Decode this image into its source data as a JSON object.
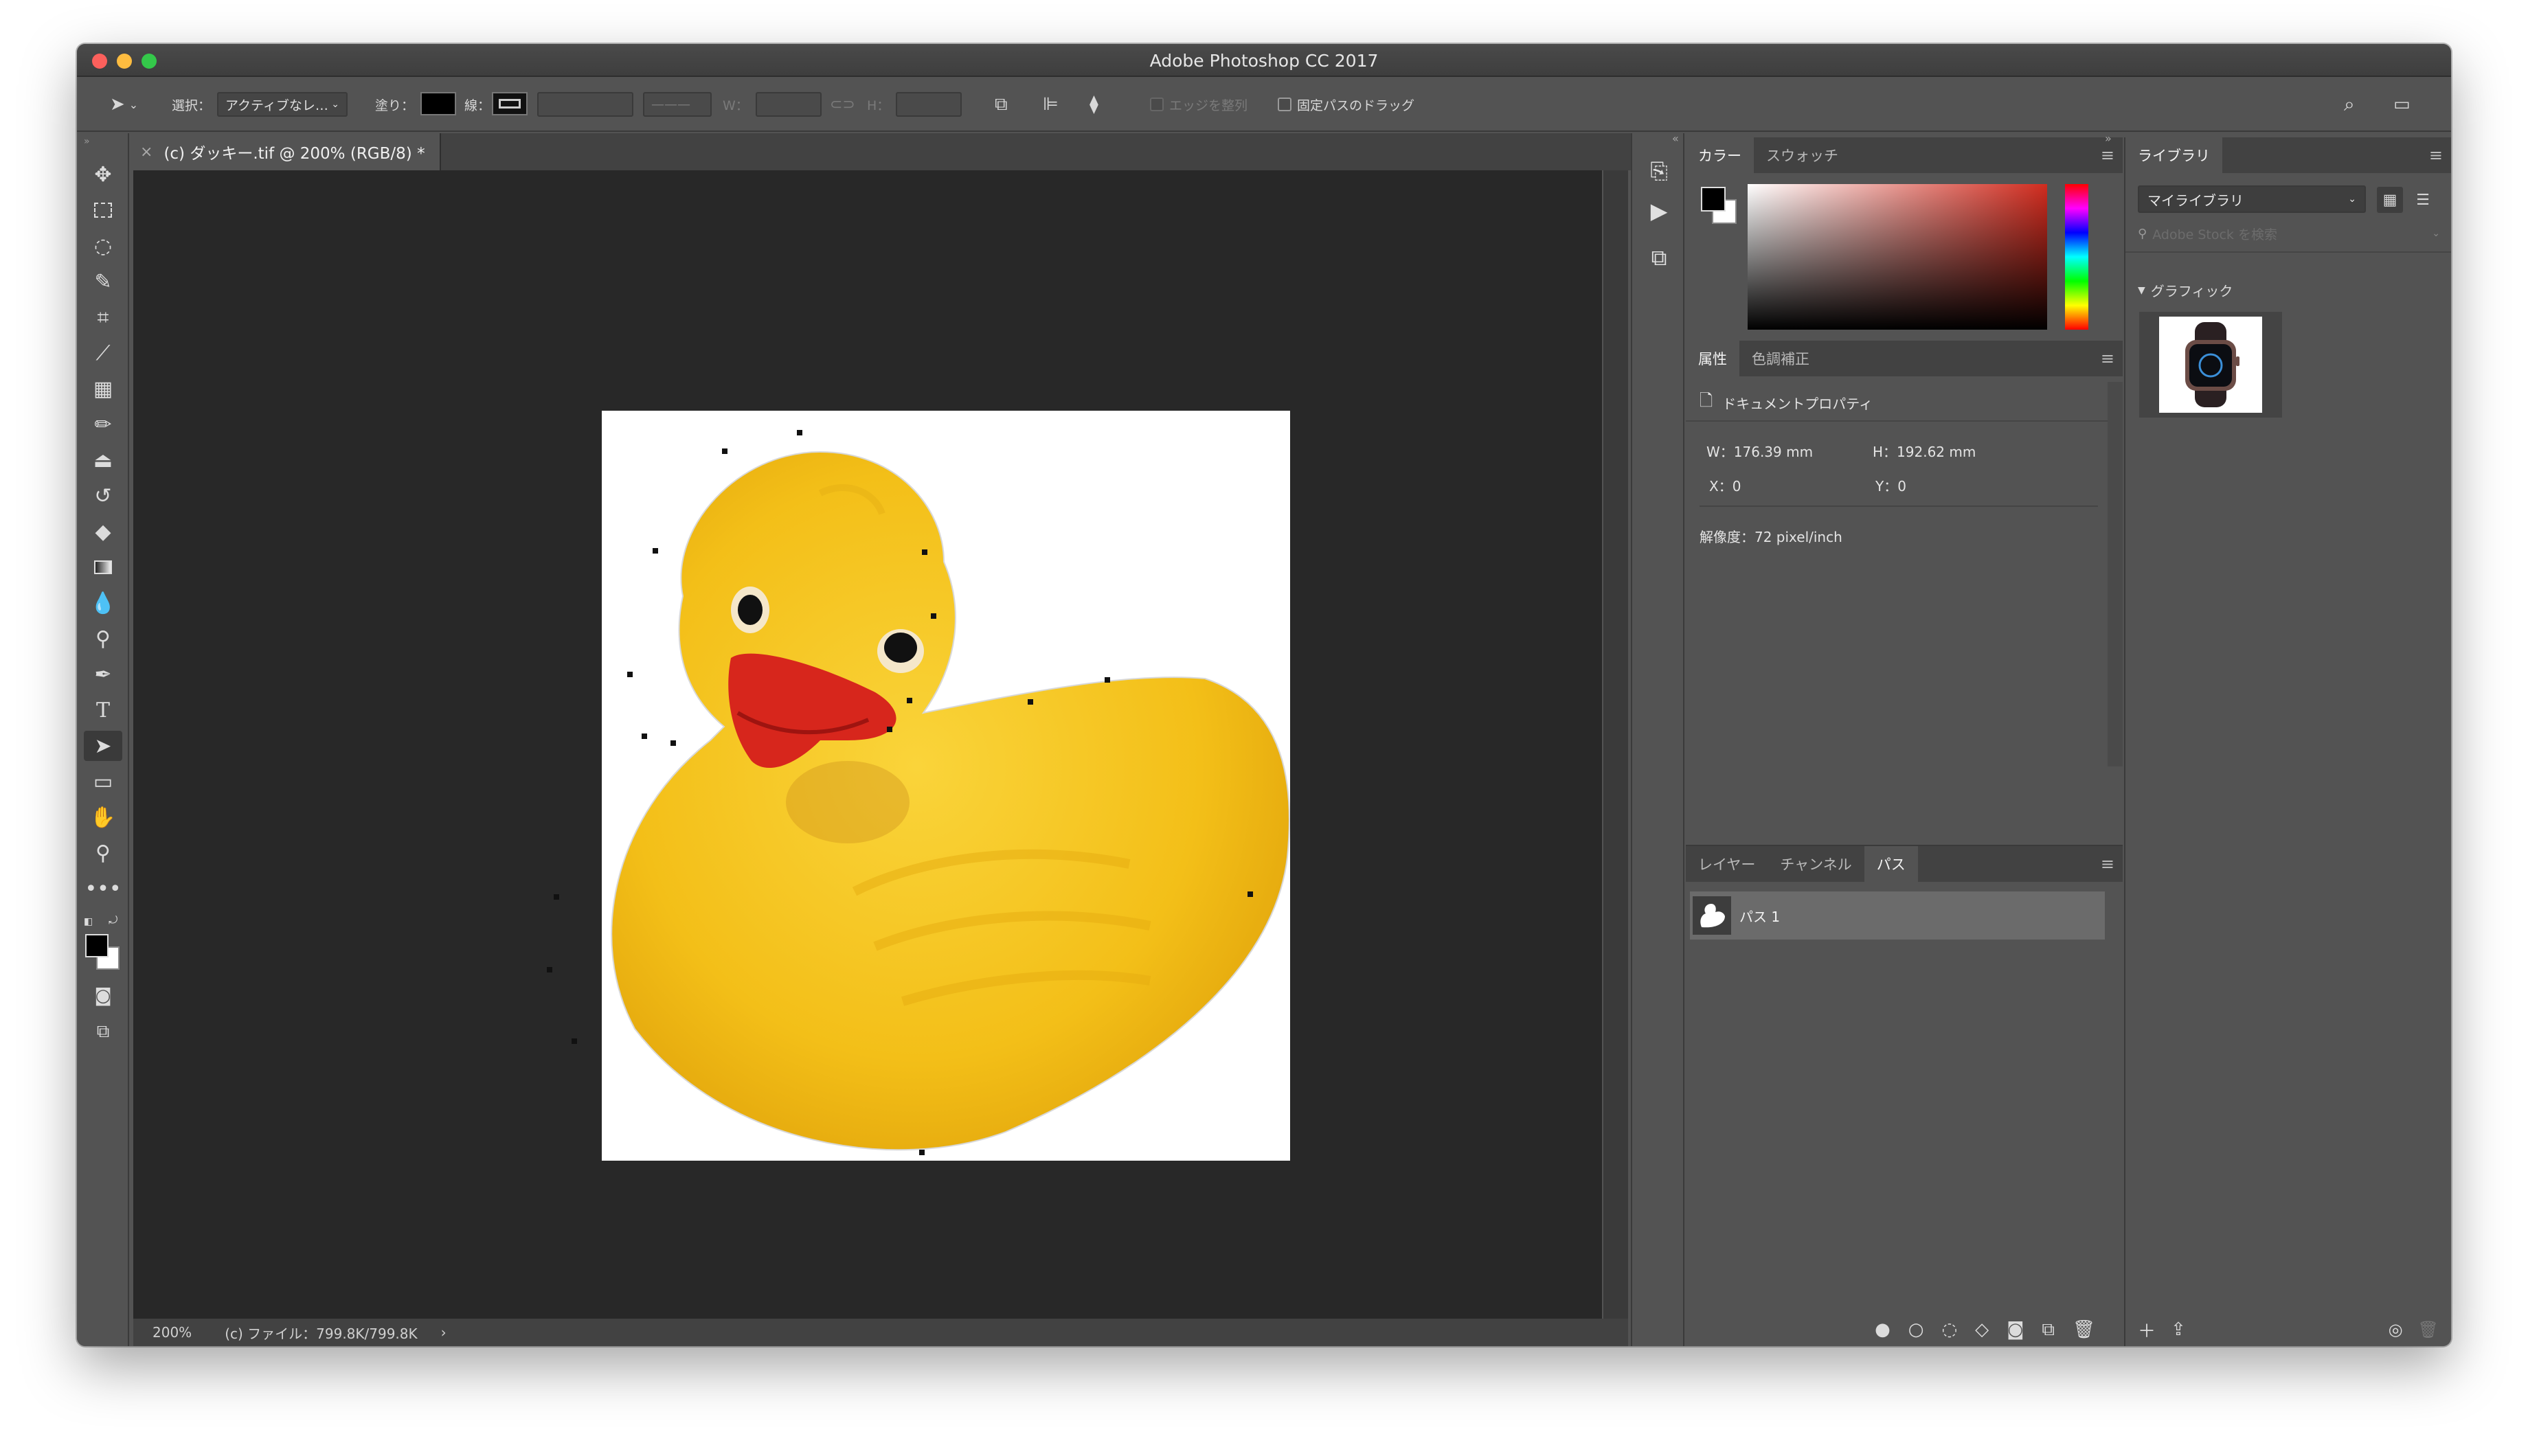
{
  "window": {
    "title": "Adobe Photoshop CC 2017"
  },
  "options_bar": {
    "select_label": "選択：",
    "select_value": "アクティブなレ…",
    "fill_label": "塗り：",
    "stroke_label": "線：",
    "w_label": "W：",
    "h_label": "H：",
    "align_edges": "エッジを整列",
    "constrain_path": "固定パスのドラッグ"
  },
  "document_tab": {
    "title": "(c) ダッキー.tif @ 200% (RGB/8) *",
    "close": "×"
  },
  "status_bar": {
    "zoom": "200%",
    "info": "(c) ファイル：799.8K/799.8K",
    "arrow": "›"
  },
  "color_panel": {
    "tabs": [
      "カラー",
      "スウォッチ"
    ],
    "active": "カラー",
    "fg": "#000000",
    "bg": "#ffffff",
    "hue_base": "#d12c1f"
  },
  "properties_panel": {
    "tabs": [
      "属性",
      "色調補正"
    ],
    "active": "属性",
    "header": "ドキュメントプロパティ",
    "w": "W：176.39 mm",
    "h": "H：192.62 mm",
    "x": "X：0",
    "y": "Y：0",
    "resolution": "解像度：72 pixel/inch"
  },
  "layers_panel": {
    "tabs": [
      "レイヤー",
      "チャンネル",
      "パス"
    ],
    "active": "パス",
    "paths": [
      {
        "name": "パス 1"
      }
    ]
  },
  "library_panel": {
    "tab": "ライブラリ",
    "library": "マイライブラリ",
    "search_placeholder": "Adobe Stock を検索",
    "section": "グラフィック"
  },
  "colors": {
    "bg": "#535353",
    "canvas_bg": "#282828",
    "duck": "#f6c21c",
    "beak": "#d7261c"
  }
}
